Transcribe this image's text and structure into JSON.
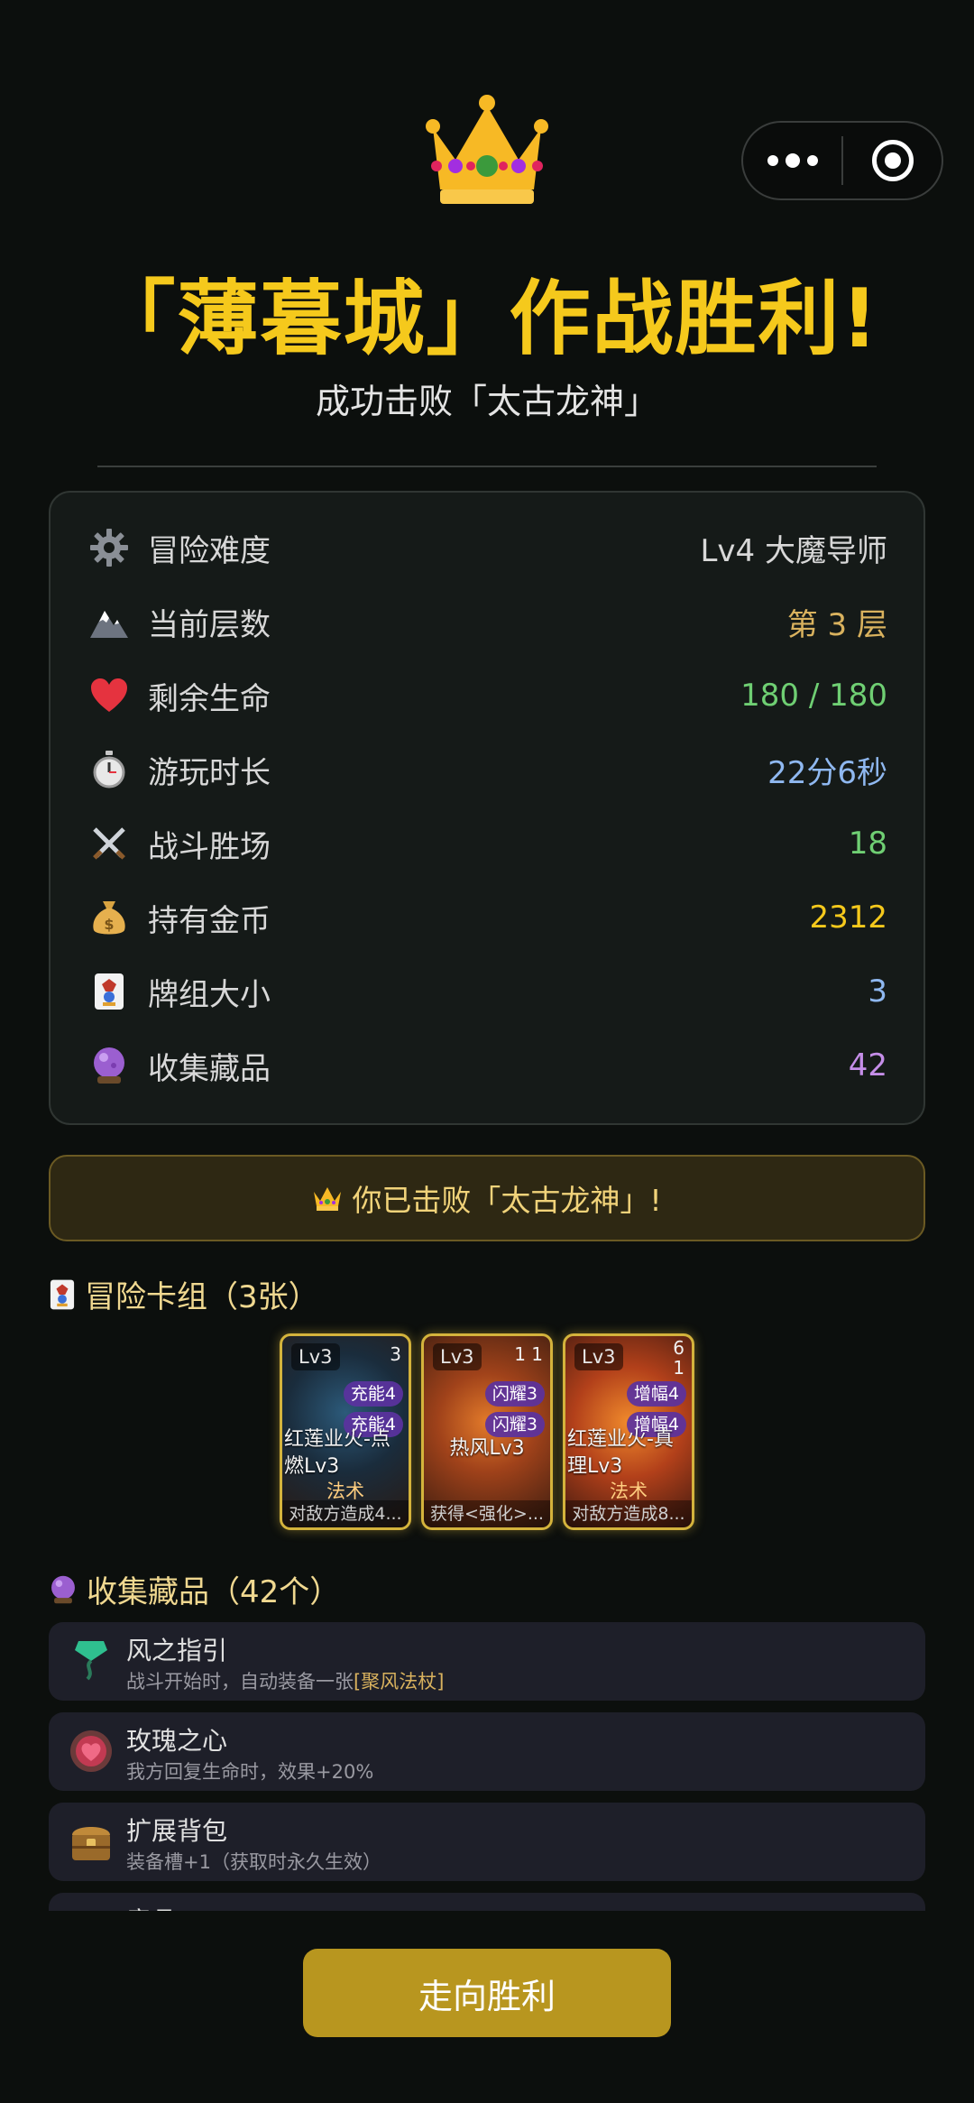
{
  "header": {
    "title": "「薄暮城」作战胜利!",
    "subtitle": "成功击败「太古龙神」"
  },
  "stats": [
    {
      "icon": "gear-icon",
      "label": "冒险难度",
      "value": "Lv4 大魔导师",
      "color": "#d8d8d8"
    },
    {
      "icon": "mountain-icon",
      "label": "当前层数",
      "value": "第 3 层",
      "color": "#d9b25e"
    },
    {
      "icon": "heart-icon",
      "label": "剩余生命",
      "value": "180 / 180",
      "color": "#6fcf73"
    },
    {
      "icon": "stopwatch-icon",
      "label": "游玩时长",
      "value": "22分6秒",
      "color": "#8fb8f0"
    },
    {
      "icon": "crossed-swords-icon",
      "label": "战斗胜场",
      "value": "18",
      "color": "#6fcf73"
    },
    {
      "icon": "money-bag-icon",
      "label": "持有金币",
      "value": "2312",
      "color": "#f5c91c"
    },
    {
      "icon": "joker-card-icon",
      "label": "牌组大小",
      "value": "3",
      "color": "#8fb8f0"
    },
    {
      "icon": "crystal-ball-icon",
      "label": "收集藏品",
      "value": "42",
      "color": "#c58ee8"
    }
  ],
  "banner": {
    "text": "你已击败「太古龙神」!"
  },
  "deck": {
    "title": "冒险卡组（3张）",
    "cards": [
      {
        "level": "Lv3",
        "corner": "3",
        "tags": [
          "充能4",
          "充能4"
        ],
        "name": "红莲业火-点燃Lv3",
        "type": "法术",
        "desc": "对敌方造成4..."
      },
      {
        "level": "Lv3",
        "corner": "1  1",
        "tags": [
          "闪耀3",
          "闪耀3"
        ],
        "name": "热风Lv3",
        "type": "",
        "desc": "获得<强化>..."
      },
      {
        "level": "Lv3",
        "corner": "6\n1",
        "tags": [
          "增幅4",
          "增幅4"
        ],
        "name": "红莲业火-真理Lv3",
        "type": "法术",
        "desc": "对敌方造成8..."
      }
    ]
  },
  "relics": {
    "title": "收集藏品（42个）",
    "items": [
      {
        "name": "风之指引",
        "desc_prefix": "战斗开始时，自动装备一张",
        "desc_highlight": "[聚风法杖]"
      },
      {
        "name": "玫瑰之心",
        "desc_prefix": "我方回复生命时，效果+20%",
        "desc_highlight": ""
      },
      {
        "name": "扩展背包",
        "desc_prefix": "装备槽+1（获取时永久生效）",
        "desc_highlight": ""
      },
      {
        "name": "意品",
        "desc_prefix": "",
        "desc_highlight": ""
      }
    ]
  },
  "cta": {
    "label": "走向胜利"
  }
}
